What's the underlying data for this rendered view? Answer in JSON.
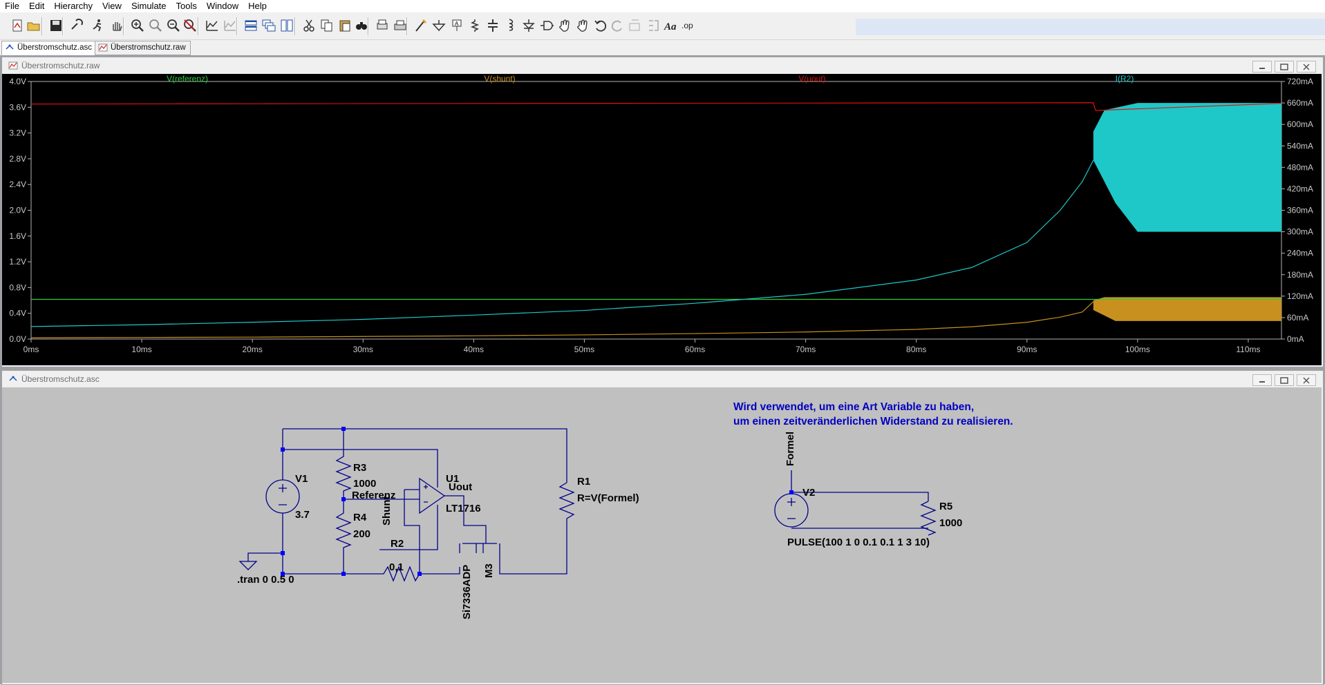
{
  "menu": [
    "File",
    "Edit",
    "Hierarchy",
    "View",
    "Simulate",
    "Tools",
    "Window",
    "Help"
  ],
  "toolbar_icons": [
    "new-schematic",
    "open",
    "save",
    "control-panel",
    "run",
    "halt",
    "zoom-in",
    "zoom-pan",
    "zoom-out",
    "zoom-cancel",
    "autorange",
    "delete-trace",
    "tile-horizontal",
    "cascade",
    "tile-vertical",
    "cut",
    "copy",
    "paste",
    "find",
    "print-preview",
    "print",
    "wire",
    "ground",
    "label-net",
    "resistor",
    "capacitor",
    "inductor",
    "diode",
    "component",
    "move",
    "drag",
    "undo",
    "redo",
    "rotate",
    "mirror",
    "text",
    "spice-directive"
  ],
  "tabs": [
    {
      "label": "Überstromschutz.asc",
      "active": true
    },
    {
      "label": "Überstromschutz.raw",
      "active": false
    }
  ],
  "plot_window": {
    "title": "Überstromschutz.raw"
  },
  "schem_window": {
    "title": "Überstromschutz.asc"
  },
  "chart_data": {
    "type": "line",
    "series": [
      {
        "name": "V(referenz)",
        "color": "#2ecc40",
        "axis": "left"
      },
      {
        "name": "V(shunt)",
        "color": "#c8901e",
        "axis": "left"
      },
      {
        "name": "V(uout)",
        "color": "#e01010",
        "axis": "left"
      },
      {
        "name": "I(R2)",
        "color": "#1ec8c8",
        "axis": "right"
      }
    ],
    "xlim": [
      0,
      113
    ],
    "x_ticks": [
      "0ms",
      "10ms",
      "20ms",
      "30ms",
      "40ms",
      "50ms",
      "60ms",
      "70ms",
      "80ms",
      "90ms",
      "100ms",
      "110ms"
    ],
    "x_tick_values": [
      0,
      10,
      20,
      30,
      40,
      50,
      60,
      70,
      80,
      90,
      100,
      110
    ],
    "ylim_left": [
      0,
      4.0
    ],
    "y_ticks_left": [
      "0.0V",
      "0.4V",
      "0.8V",
      "1.2V",
      "1.6V",
      "2.0V",
      "2.4V",
      "2.8V",
      "3.2V",
      "3.6V",
      "4.0V"
    ],
    "ylim_right": [
      0,
      720
    ],
    "y_ticks_right": [
      "0mA",
      "60mA",
      "120mA",
      "180mA",
      "240mA",
      "300mA",
      "360mA",
      "420mA",
      "480mA",
      "540mA",
      "600mA",
      "660mA",
      "720mA"
    ],
    "data": {
      "V(referenz)": {
        "x": [
          0,
          113
        ],
        "y": [
          0.617,
          0.617
        ]
      },
      "V(uout)": {
        "x": [
          0,
          96,
          96.2,
          113
        ],
        "y": [
          3.65,
          3.67,
          3.55,
          3.66
        ]
      },
      "I(R2)": {
        "x": [
          0,
          10,
          20,
          30,
          40,
          50,
          60,
          70,
          80,
          85,
          90,
          93,
          95,
          96
        ],
        "y": [
          35,
          40,
          47,
          55,
          67,
          80,
          100,
          125,
          165,
          200,
          270,
          360,
          440,
          500
        ]
      },
      "V(shunt)": {
        "x": [
          0,
          10,
          20,
          30,
          40,
          50,
          60,
          70,
          80,
          85,
          90,
          93,
          95,
          96
        ],
        "y": [
          0.02,
          0.025,
          0.03,
          0.04,
          0.05,
          0.065,
          0.085,
          0.11,
          0.15,
          0.19,
          0.26,
          0.34,
          0.42,
          0.58
        ]
      },
      "I(R2)_band": {
        "x_start": 96,
        "x_end": 113,
        "upper": 660,
        "lower_start": 500,
        "lower_end": 300
      },
      "V(shunt)_band": {
        "x_start": 96,
        "x_end": 113,
        "upper": 0.65,
        "lower": 0.28
      }
    }
  },
  "schematic": {
    "comment_line1": "Wird verwendet, um eine Art Variable zu haben,",
    "comment_line2": "um einen zeitveränderlichen Widerstand zu realisieren.",
    "V1": "V1",
    "V1_value": "3.7",
    "R3": "R3",
    "R3_value": "1000",
    "R4": "R4",
    "R4_value": "200",
    "R1": "R1",
    "R1_value": "R=V(Formel)",
    "R2": "R2",
    "R2_value": "0,1",
    "U1": "U1",
    "U1_value": "LT1716",
    "Uout": "Uout",
    "Referenz": "Referenz",
    "Shunt": "Shunt",
    "M3": "M3",
    "M3_value": "Si7336ADP",
    "tran": ".tran 0 0.5 0",
    "Formel": "Formel",
    "V2": "V2",
    "V2_value": "PULSE(100 1 0 0.1 0.1 1 3 10)",
    "R5": "R5",
    "R5_value": "1000"
  }
}
